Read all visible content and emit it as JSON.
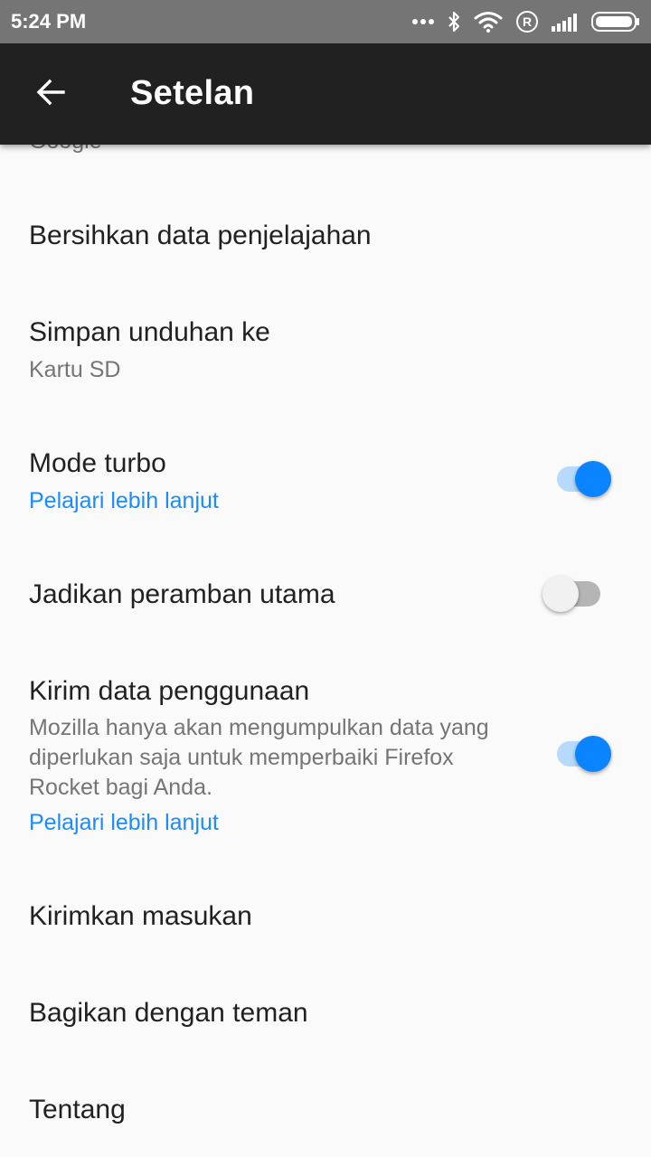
{
  "status_bar": {
    "time": "5:24 PM",
    "icons": [
      "more-dots-icon",
      "bluetooth-icon",
      "wifi-icon",
      "roaming-icon",
      "signal-icon",
      "battery-icon"
    ]
  },
  "app_bar": {
    "back_icon": "arrow-left-icon",
    "title": "Setelan"
  },
  "settings": {
    "search_engine_value": "Google",
    "clear_data": {
      "label": "Bersihkan data penjelajahan"
    },
    "download_location": {
      "label": "Simpan unduhan ke",
      "value": "Kartu SD"
    },
    "turbo_mode": {
      "label": "Mode turbo",
      "link": "Pelajari lebih lanjut",
      "enabled": true
    },
    "default_browser": {
      "label": "Jadikan peramban utama",
      "enabled": false
    },
    "telemetry": {
      "label": "Kirim data penggunaan",
      "description": "Mozilla hanya akan mengumpulkan data yang diperlukan saja untuk memperbaiki Firefox Rocket bagi Anda.",
      "link": "Pelajari lebih lanjut",
      "enabled": true
    },
    "feedback": {
      "label": "Kirimkan masukan"
    },
    "share": {
      "label": "Bagikan dengan teman"
    },
    "about": {
      "label": "Tentang"
    }
  },
  "colors": {
    "accent": "#0a84ff",
    "link": "#1a8cff",
    "toolbar": "#212121",
    "status_bar": "#757575",
    "background": "#fafafa"
  }
}
